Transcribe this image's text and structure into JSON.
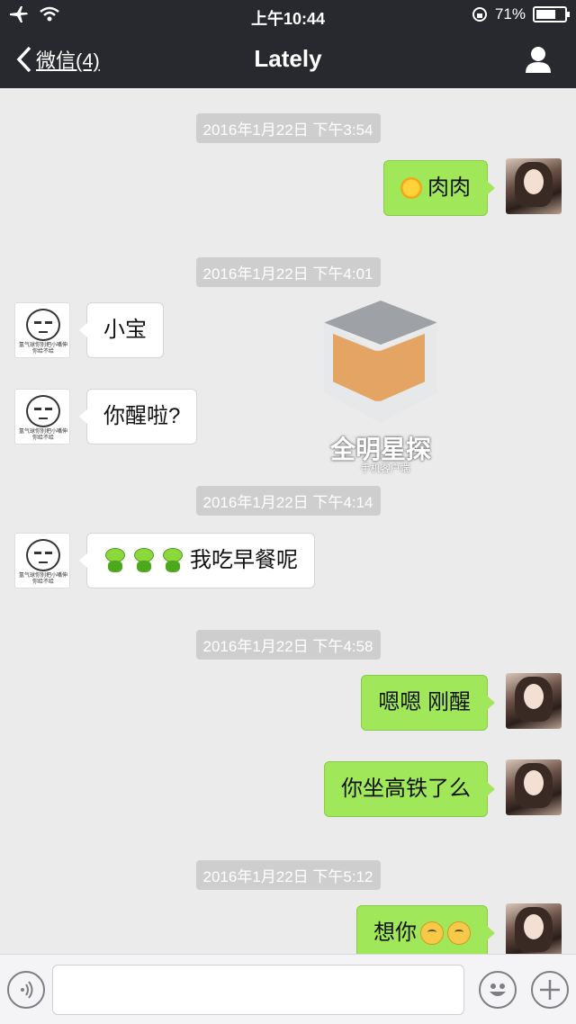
{
  "status_bar": {
    "time": "上午10:44",
    "battery": "71%",
    "battery_level": 0.71
  },
  "nav": {
    "back_label": "微信(4)",
    "title": "Lately"
  },
  "messages": [
    {
      "timestamp": "2016年1月22日 下午3:54"
    },
    {
      "from": "me",
      "text": "肉肉",
      "emoji": "sun-emoji"
    },
    {
      "timestamp": "2016年1月22日 下午4:01"
    },
    {
      "from": "them",
      "text": "小宝"
    },
    {
      "from": "them",
      "text": "你醒啦?"
    },
    {
      "timestamp": "2016年1月22日 下午4:14"
    },
    {
      "from": "them",
      "text": "我吃早餐呢",
      "emoji": "frog-emoji x3"
    },
    {
      "timestamp": "2016年1月22日 下午4:58"
    },
    {
      "from": "me",
      "text": "嗯嗯 刚醒"
    },
    {
      "from": "me",
      "text": "你坐高铁了么"
    },
    {
      "timestamp": "2016年1月22日 下午5:12"
    },
    {
      "from": "me",
      "text": "想你",
      "emoji": "face-emoji x2"
    }
  ],
  "avatar_caption": "氢气球你别把小嘴伸你给不给",
  "watermark": {
    "text": "全明星探",
    "subtext": "手机客户端"
  },
  "input_bar": {
    "placeholder": ""
  },
  "colors": {
    "header": "#28292e",
    "bubble_me": "#a0e759",
    "bubble_them": "#ffffff",
    "background": "#ebebeb"
  },
  "icons": [
    "airplane-icon",
    "wifi-icon",
    "lock-rotation-icon",
    "battery-icon",
    "chevron-left-icon",
    "person-icon",
    "voice-icon",
    "emoji-icon",
    "plus-icon"
  ]
}
